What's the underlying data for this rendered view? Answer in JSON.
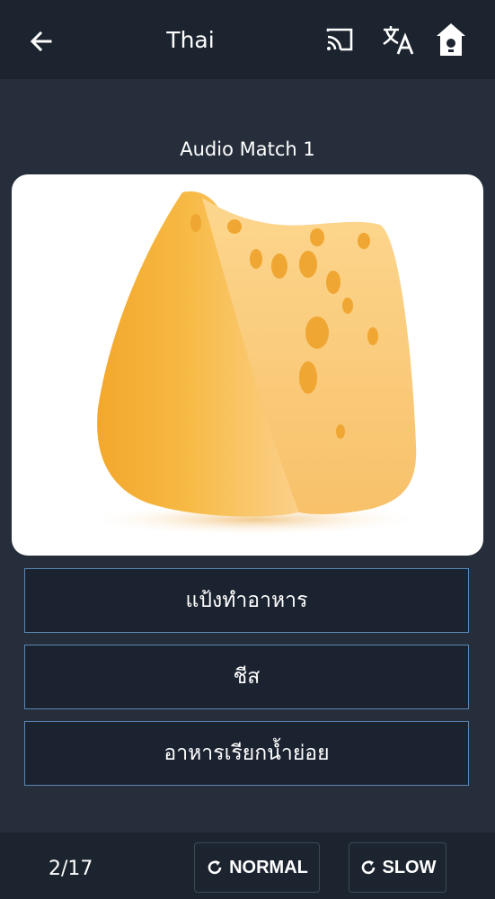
{
  "header": {
    "title": "Thai",
    "icons": [
      "back-arrow-icon",
      "cast-icon",
      "translate-icon",
      "birdhouse-icon"
    ]
  },
  "exercise": {
    "title": "Audio Match 1",
    "image_subject": "cheese wedge"
  },
  "options": [
    {
      "label": "แป้งทำอาหาร"
    },
    {
      "label": "ชีส"
    },
    {
      "label": "อาหารเรียกน้ำย่อย"
    }
  ],
  "footer": {
    "progress": "2/17",
    "normal_label": "NORMAL",
    "slow_label": "SLOW",
    "replay_icon": "replay-icon"
  },
  "colors": {
    "background": "#252e3a",
    "bar": "#1c2430",
    "option_border": "#5a86b3",
    "cheese": "#f6b43a"
  }
}
